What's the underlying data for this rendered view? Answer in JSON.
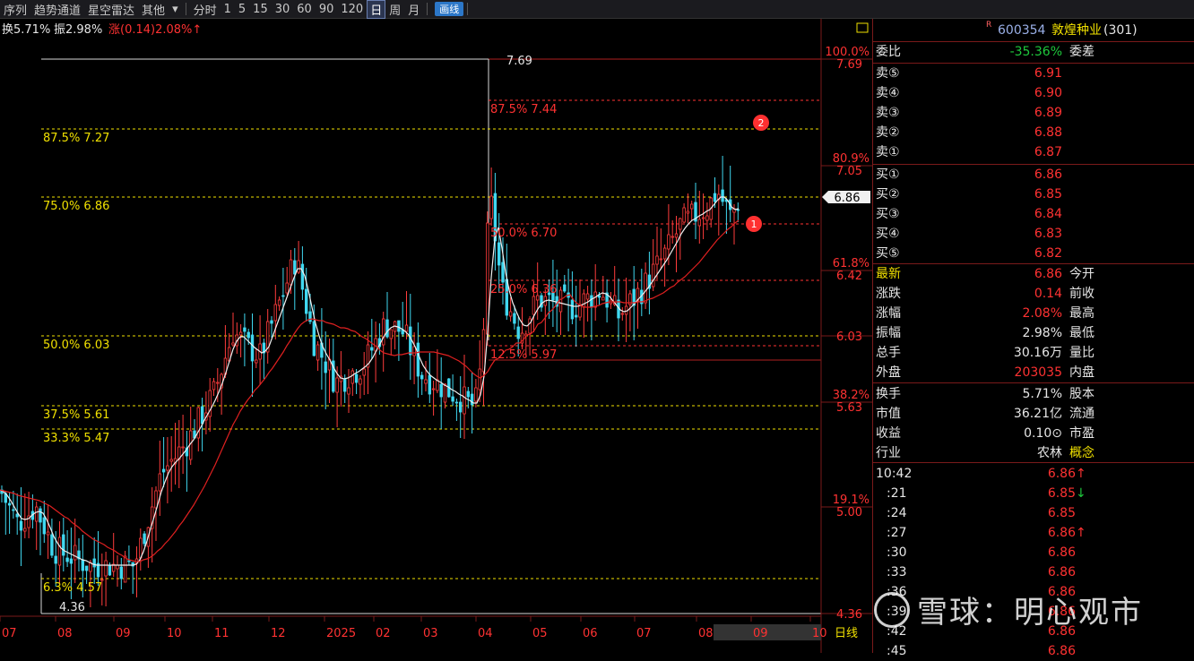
{
  "toolbar": {
    "items": [
      "序列",
      "趋势通道",
      "星空雷达",
      "其他"
    ],
    "dropdown_icon": "chevron-down-icon",
    "periods": [
      "分时",
      "1",
      "5",
      "15",
      "30",
      "60",
      "90",
      "120",
      "日",
      "周",
      "月"
    ],
    "active_period": "日",
    "draw_button": "画线"
  },
  "indicator_line": {
    "turnover": "换5.71%",
    "amplitude": "振2.98%",
    "change": "涨(0.14)2.08%↑"
  },
  "fib_labels_left": [
    {
      "text": "87.5% 7.27",
      "price": 7.27
    },
    {
      "text": "75.0% 6.86",
      "price": 6.86
    },
    {
      "text": "50.0% 6.03",
      "price": 6.03
    },
    {
      "text": "37.5% 5.61",
      "price": 5.61
    },
    {
      "text": "33.3% 5.47",
      "price": 5.47
    },
    {
      "text": "6.3% 4.57",
      "price": 4.57
    }
  ],
  "fib_labels_right": [
    {
      "text": "87.5% 7.44",
      "price": 7.44
    },
    {
      "text": "50.0% 6.70",
      "price": 6.7
    },
    {
      "text": "25.0% 6.36",
      "price": 6.36
    },
    {
      "text": "12.5% 5.97",
      "price": 5.97
    }
  ],
  "price_labels": {
    "high": "7.69",
    "low": "4.36"
  },
  "high_price": 7.69,
  "low_price": 4.36,
  "axis_right": [
    {
      "pct": "100.0%",
      "price": "7.69",
      "value": 7.69
    },
    {
      "pct": "80.9%",
      "price": "7.05",
      "value": 7.05
    },
    {
      "pct": "61.8%",
      "price": "6.42",
      "value": 6.42
    },
    {
      "pct": "",
      "price": "6.03",
      "value": 6.03
    },
    {
      "pct": "38.2%",
      "price": "5.63",
      "value": 5.63
    },
    {
      "pct": "19.1%",
      "price": "5.00",
      "value": 5.0
    },
    {
      "pct": "",
      "price": "4.36",
      "value": 4.36
    }
  ],
  "current_price_tag": "6.86",
  "current_price": 6.86,
  "markers": [
    "1",
    "2"
  ],
  "x_axis": [
    "07",
    "08",
    "09",
    "10",
    "11",
    "12",
    "2025",
    "02",
    "03",
    "04",
    "05",
    "06",
    "07",
    "08",
    "09",
    "10"
  ],
  "period_label": "日线",
  "colors": {
    "red": "#ff3232",
    "green": "#1ec83c",
    "yellow": "#f0e000",
    "ma_white": "#f0f0f0",
    "ma_red": "#e02020"
  },
  "stock": {
    "badge": "R",
    "code": "600354",
    "name": "敦煌种业",
    "count": "(301)"
  },
  "weibi": {
    "label": "委比",
    "value": "-35.36%",
    "right": "委差"
  },
  "sell": [
    {
      "label": "卖⑤",
      "price": "6.91"
    },
    {
      "label": "卖④",
      "price": "6.90"
    },
    {
      "label": "卖③",
      "price": "6.89"
    },
    {
      "label": "卖②",
      "price": "6.88"
    },
    {
      "label": "卖①",
      "price": "6.87"
    }
  ],
  "buy": [
    {
      "label": "买①",
      "price": "6.86"
    },
    {
      "label": "买②",
      "price": "6.85"
    },
    {
      "label": "买③",
      "price": "6.84"
    },
    {
      "label": "买④",
      "price": "6.83"
    },
    {
      "label": "买⑤",
      "price": "6.82"
    }
  ],
  "quote": [
    {
      "label": "最新",
      "value": "6.86",
      "right": "今开",
      "lcolor": "yellow",
      "vcolor": "red"
    },
    {
      "label": "涨跌",
      "value": "0.14",
      "right": "前收",
      "lcolor": "white",
      "vcolor": "red"
    },
    {
      "label": "涨幅",
      "value": "2.08%",
      "right": "最高",
      "lcolor": "white",
      "vcolor": "red"
    },
    {
      "label": "振幅",
      "value": "2.98%",
      "right": "最低",
      "lcolor": "white",
      "vcolor": "white"
    },
    {
      "label": "总手",
      "value": "30.16万",
      "right": "量比",
      "lcolor": "white",
      "vcolor": "white"
    },
    {
      "label": "外盘",
      "value": "203035",
      "right": "内盘",
      "lcolor": "white",
      "vcolor": "red"
    }
  ],
  "stats": [
    {
      "label": "换手",
      "value": "5.71%",
      "right": "股本",
      "rcolor": "white"
    },
    {
      "label": "市值",
      "value": "36.21亿",
      "right": "流通",
      "rcolor": "white"
    },
    {
      "label": "收益",
      "value": "0.10⊙",
      "right": "市盈",
      "rcolor": "white"
    },
    {
      "label": "行业",
      "value": "农林",
      "right": "概念",
      "rcolor": "yellow"
    }
  ],
  "ticks": [
    {
      "time": "10:42",
      "price": "6.86",
      "arrow": "↑"
    },
    {
      "time": ":21",
      "price": "6.85",
      "arrow": "↓"
    },
    {
      "time": ":24",
      "price": "6.85",
      "arrow": ""
    },
    {
      "time": ":27",
      "price": "6.86",
      "arrow": "↑"
    },
    {
      "time": ":30",
      "price": "6.86",
      "arrow": ""
    },
    {
      "time": ":33",
      "price": "6.86",
      "arrow": ""
    },
    {
      "time": ":36",
      "price": "6.86",
      "arrow": ""
    },
    {
      "time": ":39",
      "price": "6.86",
      "arrow": ""
    },
    {
      "time": ":42",
      "price": "6.86",
      "arrow": ""
    },
    {
      "time": ":45",
      "price": "6.86",
      "arrow": ""
    }
  ],
  "watermark": "雪球：明心观市"
}
